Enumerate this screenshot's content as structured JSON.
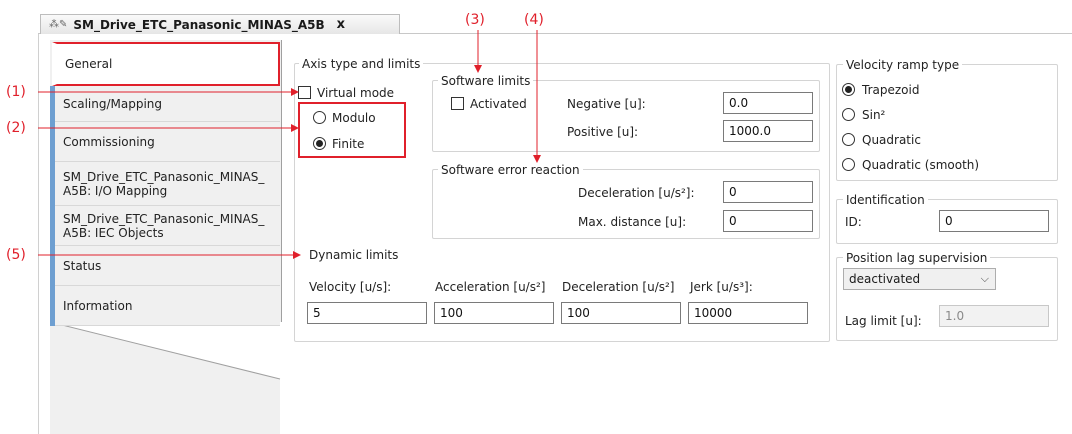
{
  "tab": {
    "icon": "fb-icon",
    "title": "SM_Drive_ETC_Panasonic_MINAS_A5B",
    "close": "x"
  },
  "nav": {
    "items": [
      {
        "label": "General"
      },
      {
        "label": "Scaling/Mapping"
      },
      {
        "label": "Commissioning"
      },
      {
        "label": "SM_Drive_ETC_Panasonic_MINAS_\nA5B: I/O Mapping"
      },
      {
        "label": "SM_Drive_ETC_Panasonic_MINAS_\nA5B: IEC Objects"
      },
      {
        "label": "Status"
      },
      {
        "label": "Information"
      }
    ],
    "selected": "General"
  },
  "axis": {
    "title": "Axis type and limits",
    "virtual_mode": {
      "label": "Virtual mode",
      "checked": false
    },
    "modulo": {
      "label": "Modulo",
      "selected": false
    },
    "finite": {
      "label": "Finite",
      "selected": true
    }
  },
  "software_limits": {
    "title": "Software limits",
    "activated": {
      "label": "Activated",
      "checked": false
    },
    "negative_label": "Negative [u]:",
    "negative_value": "0.0",
    "positive_label": "Positive [u]:",
    "positive_value": "1000.0"
  },
  "software_error": {
    "title": "Software error reaction",
    "deceleration_label": "Deceleration [u/s²]:",
    "deceleration_value": "0",
    "max_distance_label": "Max. distance [u]:",
    "max_distance_value": "0"
  },
  "dynamic": {
    "title": "Dynamic limits",
    "velocity_label": "Velocity [u/s]:",
    "velocity_value": "5",
    "acceleration_label": "Acceleration [u/s²]",
    "acceleration_value": "100",
    "deceleration_label": "Deceleration [u/s²]",
    "deceleration_value": "100",
    "jerk_label": "Jerk [u/s³]:",
    "jerk_value": "10000"
  },
  "velocity_ramp": {
    "title": "Velocity ramp type",
    "options": [
      "Trapezoid",
      "Sin²",
      "Quadratic",
      "Quadratic (smooth)"
    ],
    "selected": "Trapezoid"
  },
  "identification": {
    "title": "Identification",
    "id_label": "ID:",
    "id_value": "0"
  },
  "position_lag": {
    "title": "Position lag supervision",
    "mode": "deactivated",
    "lag_limit_label": "Lag limit [u]:",
    "lag_limit_value": "1.0"
  },
  "callouts": [
    "(1)",
    "(2)",
    "(3)",
    "(4)",
    "(5)"
  ],
  "annotation_color": "#e0202b",
  "nav_accent_color": "#6e9fd1"
}
